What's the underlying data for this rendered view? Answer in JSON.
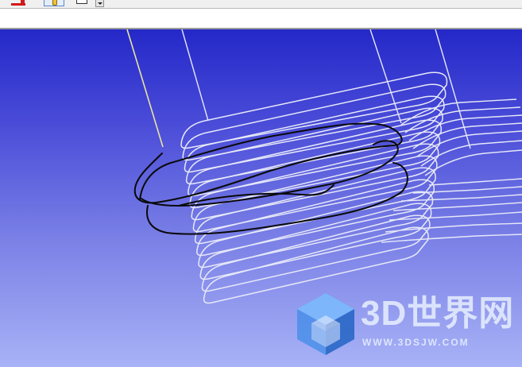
{
  "toolbar": {
    "icons": [
      "red-arrow-icon",
      "pin-icon",
      "rectangle-icon",
      "dropdown-arrow-icon"
    ]
  },
  "infobar": {
    "text": ""
  },
  "viewport": {
    "background_top": "#2428c8",
    "background_bottom": "#a8b2f6",
    "toolpath_color": "#e6e8f8",
    "axis_line_color": "#e8e4a0",
    "sketch_color": "#0a0a0a"
  },
  "watermark": {
    "title": "3D世界网",
    "url": "WWW.3DSJW.COM",
    "icon": "cube-logo-icon"
  }
}
